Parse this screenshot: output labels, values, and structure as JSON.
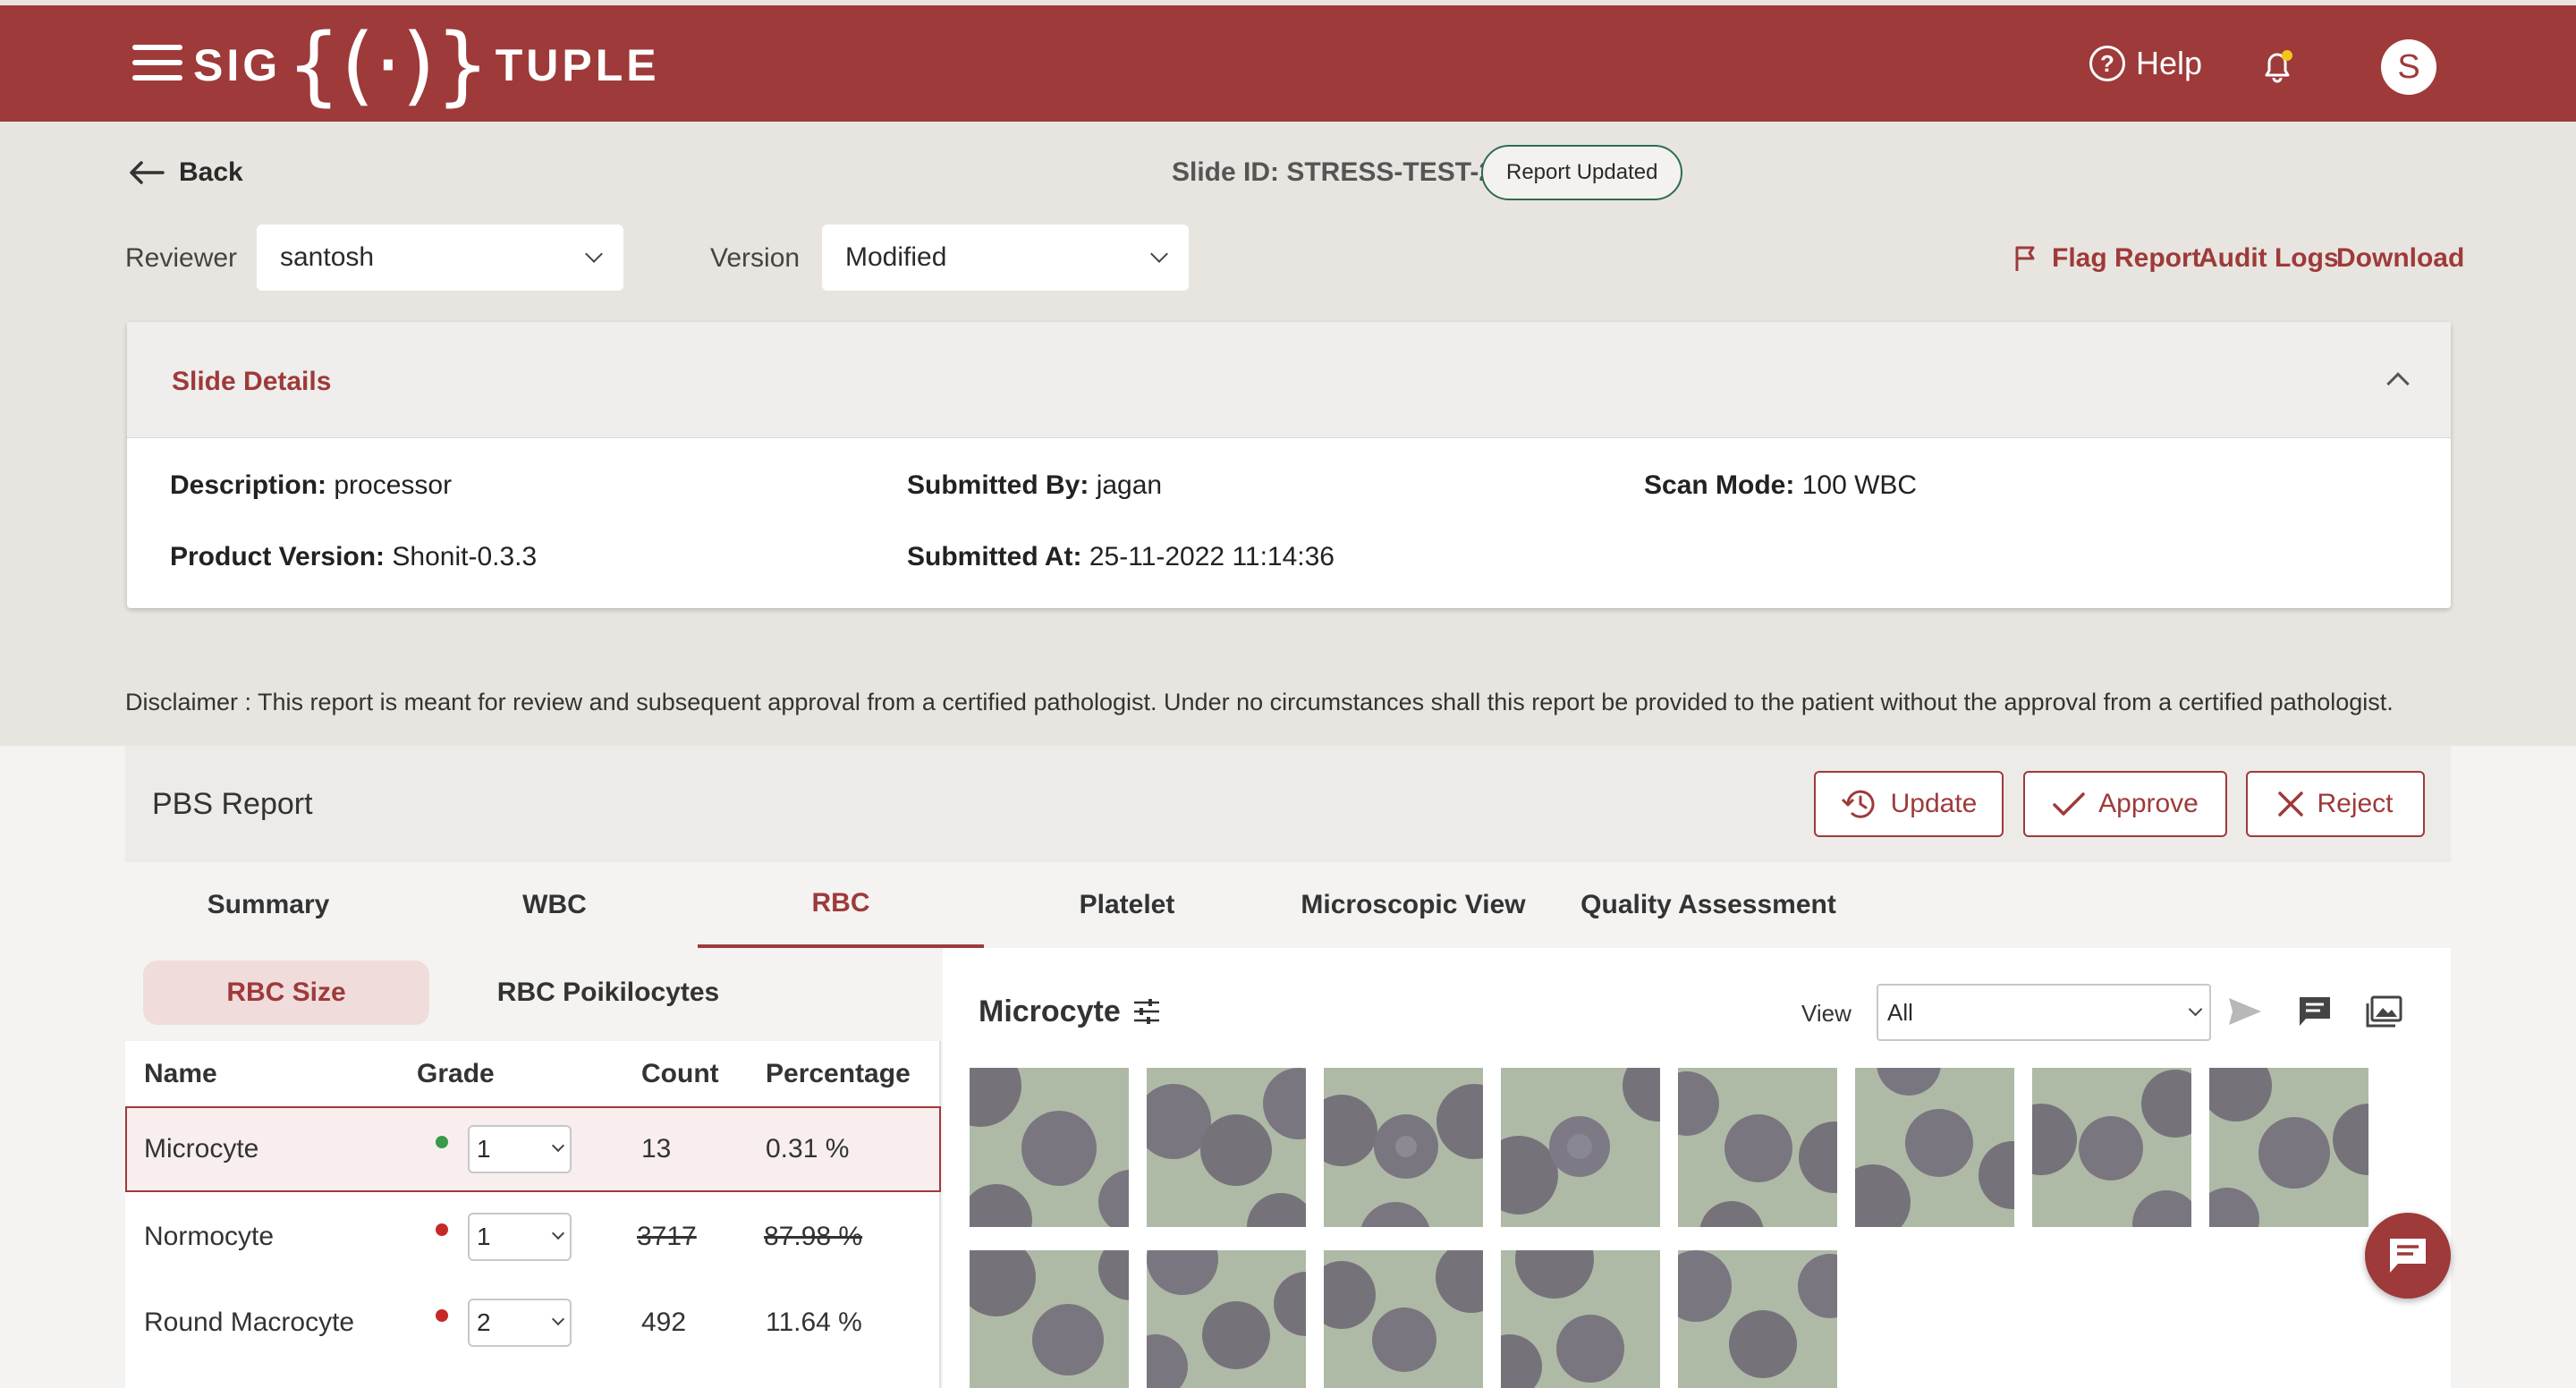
{
  "header": {
    "logo_left": "SIG",
    "logo_brace": "{(·)}",
    "logo_right": "TUPLE",
    "help_label": "Help",
    "avatar_initial": "S",
    "brand_color": "#9e3a3a"
  },
  "topbar": {
    "back_label": "Back",
    "slide_id": "Slide ID: STRESS-TEST-25",
    "status_badge": "Report Updated"
  },
  "filters": {
    "reviewer_label": "Reviewer",
    "reviewer_value": "santosh",
    "version_label": "Version",
    "version_value": "Modified",
    "flag_report": "Flag Report",
    "audit_logs": "Audit Logs",
    "download": "Download"
  },
  "slide_details": {
    "title": "Slide Details",
    "description_label": "Description:",
    "description_value": "processor",
    "product_version_label": "Product Version:",
    "product_version_value": "Shonit-0.3.3",
    "submitted_by_label": "Submitted By:",
    "submitted_by_value": "jagan",
    "submitted_at_label": "Submitted At:",
    "submitted_at_value": "25-11-2022 11:14:36",
    "scan_mode_label": "Scan Mode:",
    "scan_mode_value": "100 WBC"
  },
  "disclaimer": "Disclaimer :  This report is meant for review and subsequent approval from a certified pathologist. Under no circumstances shall this report be provided to the patient without the approval from a certified pathologist.",
  "report": {
    "title": "PBS Report",
    "update_label": "Update",
    "approve_label": "Approve",
    "reject_label": "Reject",
    "tabs": [
      "Summary",
      "WBC",
      "RBC",
      "Platelet",
      "Microscopic View",
      "Quality Assessment"
    ],
    "active_tab": "RBC"
  },
  "rbc": {
    "subtabs": [
      "RBC Size",
      "RBC Poikilocytes"
    ],
    "active_subtab": "RBC Size",
    "columns": [
      "Name",
      "Grade",
      "Count",
      "Percentage"
    ],
    "rows": [
      {
        "name": "Microcyte",
        "grade": "1",
        "count": "13",
        "percentage": "0.31 %",
        "dot_color": "#3a9a4a",
        "struck": false,
        "selected": true
      },
      {
        "name": "Normocyte",
        "grade": "1",
        "count": "3717",
        "percentage": "87.98 %",
        "dot_color": "#c62828",
        "struck": true,
        "selected": false
      },
      {
        "name": "Round Macrocyte",
        "grade": "2",
        "count": "492",
        "percentage": "11.64 %",
        "dot_color": "#c62828",
        "struck": false,
        "selected": false
      }
    ]
  },
  "gallery": {
    "title": "Microcyte",
    "view_label": "View",
    "view_value": "All"
  }
}
